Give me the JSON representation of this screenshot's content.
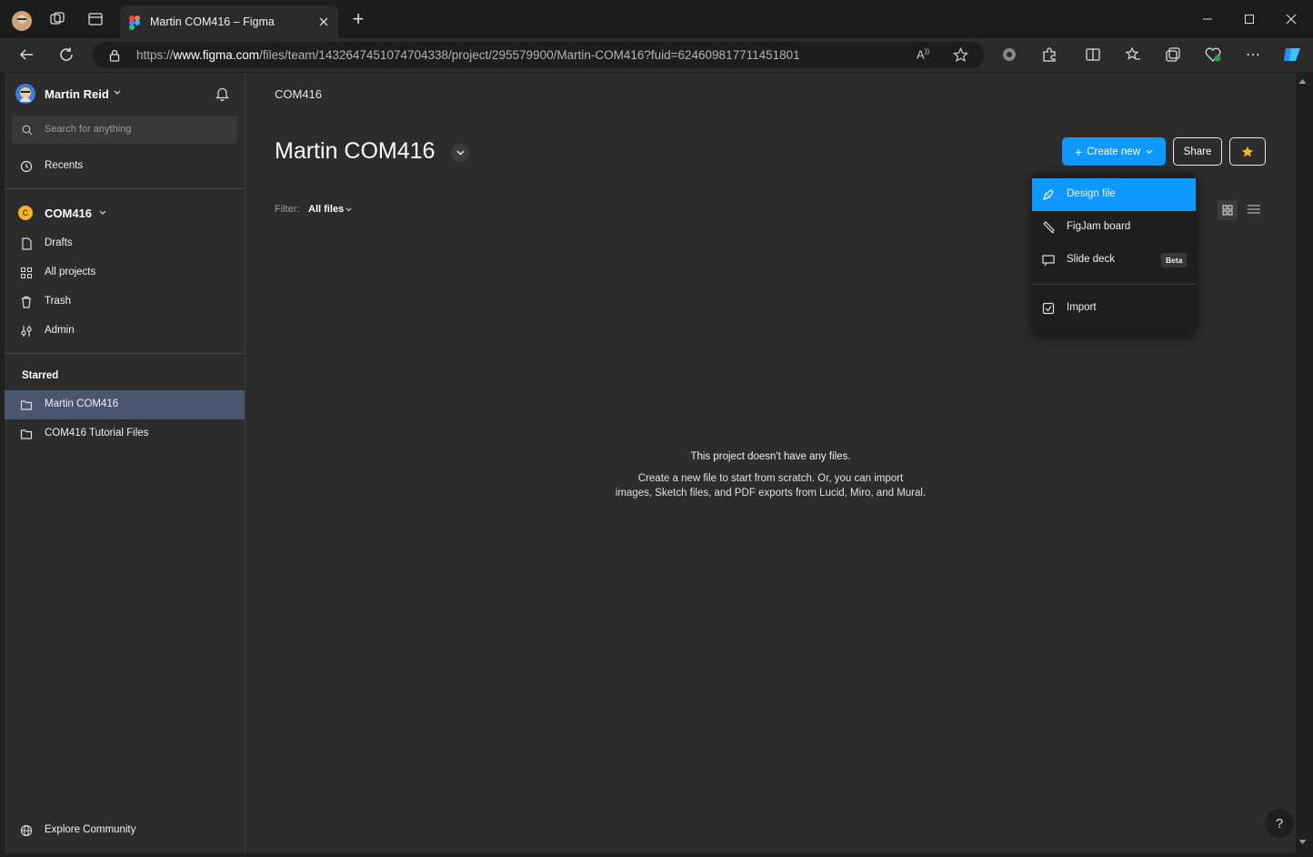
{
  "browser": {
    "tab_title": "Martin COM416 – Figma",
    "url_prefix": "https://",
    "url_host": "www.figma.com",
    "url_path": "/files/team/1432647451074704338/project/295579900/Martin-COM416?fuid=624609817711451801",
    "new_tab_label": "+"
  },
  "sidebar": {
    "user_name": "Martin Reid",
    "search_placeholder": "Search for anything",
    "recents": "Recents",
    "team_badge": "C",
    "team_name": "COM416",
    "nav": [
      {
        "label": "Drafts",
        "icon": "file-icon"
      },
      {
        "label": "All projects",
        "icon": "grid-icon"
      },
      {
        "label": "Trash",
        "icon": "trash-icon"
      },
      {
        "label": "Admin",
        "icon": "admin-icon"
      }
    ],
    "starred_heading": "Starred",
    "starred": [
      {
        "label": "Martin COM416",
        "icon": "folder-icon"
      },
      {
        "label": "COM416 Tutorial Files",
        "icon": "folder-icon"
      }
    ],
    "explore": "Explore Community"
  },
  "main": {
    "breadcrumb": "COM416",
    "title": "Martin COM416",
    "filter_label": "Filter:",
    "filter_value": "All files",
    "create_new": "Create new",
    "share": "Share",
    "empty_title": "This project doesn't have any files.",
    "empty_line1": "Create a new file to start from scratch. Or, you can import",
    "empty_line2": "images, Sketch files, and PDF exports from Lucid, Miro, and Mural.",
    "help": "?"
  },
  "menu": {
    "items": [
      {
        "label": "Design file",
        "icon": "design-file-icon"
      },
      {
        "label": "FigJam board",
        "icon": "figjam-icon"
      },
      {
        "label": "Slide deck",
        "icon": "slide-deck-icon",
        "badge": "Beta"
      },
      {
        "label": "Import",
        "icon": "import-icon"
      }
    ]
  },
  "colors": {
    "accent": "#0d99ff",
    "star": "#f5b52e",
    "active_sidebar": "#4a5570"
  }
}
